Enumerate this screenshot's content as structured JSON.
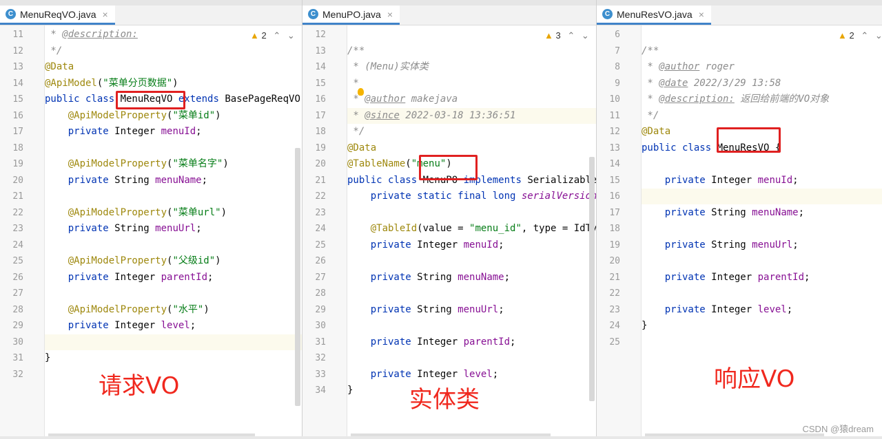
{
  "panes": [
    {
      "tab": "MenuReqVO.java",
      "tab_icon": "C",
      "close_glyph": "×",
      "warnings": "2",
      "first_line": 11,
      "current_line": 30,
      "lines": [
        [
          [
            "cmt",
            " * "
          ],
          [
            "tag",
            "@description:"
          ]
        ],
        [
          [
            "cmt",
            " */"
          ]
        ],
        [
          [
            "ann",
            "@Data"
          ]
        ],
        [
          [
            "ann",
            "@ApiModel"
          ],
          [
            "",
            "("
          ],
          [
            "str",
            "\"菜单分页数据\""
          ],
          [
            "",
            ")"
          ]
        ],
        [
          [
            "kw",
            "public class "
          ],
          [
            "",
            "MenuReqVO "
          ],
          [
            "kw",
            "extends "
          ],
          [
            "",
            "BasePageReqVO {"
          ]
        ],
        [
          [
            "",
            "    "
          ],
          [
            "ann",
            "@ApiModelProperty"
          ],
          [
            "",
            "("
          ],
          [
            "str",
            "\"菜单id\""
          ],
          [
            "",
            ")"
          ]
        ],
        [
          [
            "",
            "    "
          ],
          [
            "kw",
            "private "
          ],
          [
            "",
            "Integer "
          ],
          [
            "fld",
            "menuId"
          ],
          [
            "",
            ";"
          ]
        ],
        [],
        [
          [
            "",
            "    "
          ],
          [
            "ann",
            "@ApiModelProperty"
          ],
          [
            "",
            "("
          ],
          [
            "str",
            "\"菜单名字\""
          ],
          [
            "",
            ")"
          ]
        ],
        [
          [
            "",
            "    "
          ],
          [
            "kw",
            "private "
          ],
          [
            "",
            "String "
          ],
          [
            "fld",
            "menuName"
          ],
          [
            "",
            ";"
          ]
        ],
        [],
        [
          [
            "",
            "    "
          ],
          [
            "ann",
            "@ApiModelProperty"
          ],
          [
            "",
            "("
          ],
          [
            "str",
            "\"菜单url\""
          ],
          [
            "",
            ")"
          ]
        ],
        [
          [
            "",
            "    "
          ],
          [
            "kw",
            "private "
          ],
          [
            "",
            "String "
          ],
          [
            "fld",
            "menuUrl"
          ],
          [
            "",
            ";"
          ]
        ],
        [],
        [
          [
            "",
            "    "
          ],
          [
            "ann",
            "@ApiModelProperty"
          ],
          [
            "",
            "("
          ],
          [
            "str",
            "\"父级id\""
          ],
          [
            "",
            ")"
          ]
        ],
        [
          [
            "",
            "    "
          ],
          [
            "kw",
            "private "
          ],
          [
            "",
            "Integer "
          ],
          [
            "fld",
            "parentId"
          ],
          [
            "",
            ";"
          ]
        ],
        [],
        [
          [
            "",
            "    "
          ],
          [
            "ann",
            "@ApiModelProperty"
          ],
          [
            "",
            "("
          ],
          [
            "str",
            "\"水平\""
          ],
          [
            "",
            ")"
          ]
        ],
        [
          [
            "",
            "    "
          ],
          [
            "kw",
            "private "
          ],
          [
            "",
            "Integer "
          ],
          [
            "fld",
            "level"
          ],
          [
            "",
            ";"
          ]
        ],
        [],
        [
          [
            "",
            "}"
          ]
        ],
        []
      ],
      "caption": "请求VO"
    },
    {
      "tab": "MenuPO.java",
      "tab_icon": "C",
      "close_glyph": "×",
      "warnings": "3",
      "first_line": 12,
      "current_line": 17,
      "lines": [
        [],
        [
          [
            "cmt",
            "/**"
          ]
        ],
        [
          [
            "cmt",
            " * (Menu)实体类"
          ]
        ],
        [
          [
            "cmt",
            " *"
          ]
        ],
        [
          [
            "cmt",
            " * "
          ],
          [
            "tag",
            "@author"
          ],
          [
            "cmt",
            " makejava"
          ]
        ],
        [
          [
            "cmt",
            " * "
          ],
          [
            "tag",
            "@since"
          ],
          [
            "cmt",
            " 2022-03-18 13:36:51"
          ]
        ],
        [
          [
            "cmt",
            " */"
          ]
        ],
        [
          [
            "ann",
            "@Data"
          ]
        ],
        [
          [
            "ann",
            "@TableName"
          ],
          [
            "",
            "("
          ],
          [
            "str",
            "\"menu\""
          ],
          [
            "",
            ")"
          ]
        ],
        [
          [
            "kw",
            "public class "
          ],
          [
            "",
            "MenuPO "
          ],
          [
            "kw",
            "implements "
          ],
          [
            "",
            "Serializable {"
          ]
        ],
        [
          [
            "",
            "    "
          ],
          [
            "kw",
            "private static final long "
          ],
          [
            "sfld",
            "serialVersionUID"
          ]
        ],
        [],
        [
          [
            "",
            "    "
          ],
          [
            "ann",
            "@TableId"
          ],
          [
            "",
            "(value = "
          ],
          [
            "str",
            "\"menu_id\""
          ],
          [
            "",
            ", type = IdType"
          ]
        ],
        [
          [
            "",
            "    "
          ],
          [
            "kw",
            "private "
          ],
          [
            "",
            "Integer "
          ],
          [
            "fld",
            "menuId"
          ],
          [
            "",
            ";"
          ]
        ],
        [],
        [
          [
            "",
            "    "
          ],
          [
            "kw",
            "private "
          ],
          [
            "",
            "String "
          ],
          [
            "fld",
            "menuName"
          ],
          [
            "",
            ";"
          ]
        ],
        [],
        [
          [
            "",
            "    "
          ],
          [
            "kw",
            "private "
          ],
          [
            "",
            "String "
          ],
          [
            "fld",
            "menuUrl"
          ],
          [
            "",
            ";"
          ]
        ],
        [],
        [
          [
            "",
            "    "
          ],
          [
            "kw",
            "private "
          ],
          [
            "",
            "Integer "
          ],
          [
            "fld",
            "parentId"
          ],
          [
            "",
            ";"
          ]
        ],
        [],
        [
          [
            "",
            "    "
          ],
          [
            "kw",
            "private "
          ],
          [
            "",
            "Integer "
          ],
          [
            "fld",
            "level"
          ],
          [
            "",
            ";"
          ]
        ],
        [
          [
            "",
            "}"
          ]
        ]
      ],
      "caption": "实体类"
    },
    {
      "tab": "MenuResVO.java",
      "tab_icon": "C",
      "close_glyph": "×",
      "warnings": "2",
      "first_line": 6,
      "current_line": 16,
      "lines": [
        [],
        [
          [
            "cmt",
            "/**"
          ]
        ],
        [
          [
            "cmt",
            " * "
          ],
          [
            "tag",
            "@author"
          ],
          [
            "cmt",
            " roger"
          ]
        ],
        [
          [
            "cmt",
            " * "
          ],
          [
            "tag",
            "@date"
          ],
          [
            "cmt",
            " 2022/3/29 13:58"
          ]
        ],
        [
          [
            "cmt",
            " * "
          ],
          [
            "tag",
            "@description:"
          ],
          [
            "cmt",
            " 返回给前端的VO对象"
          ]
        ],
        [
          [
            "cmt",
            " */"
          ]
        ],
        [
          [
            "ann",
            "@Data"
          ]
        ],
        [
          [
            "kw",
            "public class "
          ],
          [
            "",
            "MenuResVO {"
          ]
        ],
        [],
        [
          [
            "",
            "    "
          ],
          [
            "kw",
            "private "
          ],
          [
            "",
            "Integer "
          ],
          [
            "fld",
            "menuId"
          ],
          [
            "",
            ";"
          ]
        ],
        [],
        [
          [
            "",
            "    "
          ],
          [
            "kw",
            "private "
          ],
          [
            "",
            "String "
          ],
          [
            "fld",
            "menuName"
          ],
          [
            "",
            ";"
          ]
        ],
        [],
        [
          [
            "",
            "    "
          ],
          [
            "kw",
            "private "
          ],
          [
            "",
            "String "
          ],
          [
            "fld",
            "menuUrl"
          ],
          [
            "",
            ";"
          ]
        ],
        [],
        [
          [
            "",
            "    "
          ],
          [
            "kw",
            "private "
          ],
          [
            "",
            "Integer "
          ],
          [
            "fld",
            "parentId"
          ],
          [
            "",
            ";"
          ]
        ],
        [],
        [
          [
            "",
            "    "
          ],
          [
            "kw",
            "private "
          ],
          [
            "",
            "Integer "
          ],
          [
            "fld",
            "level"
          ],
          [
            "",
            ";"
          ]
        ],
        [
          [
            "",
            "}"
          ]
        ],
        []
      ],
      "caption": "响应VO"
    }
  ],
  "watermark": "CSDN @猿dream",
  "colors": {
    "annotation_red": "#e02020",
    "caption_red": "#f0281e",
    "keyword": "#0033b3",
    "string": "#067d17",
    "field": "#871094"
  }
}
